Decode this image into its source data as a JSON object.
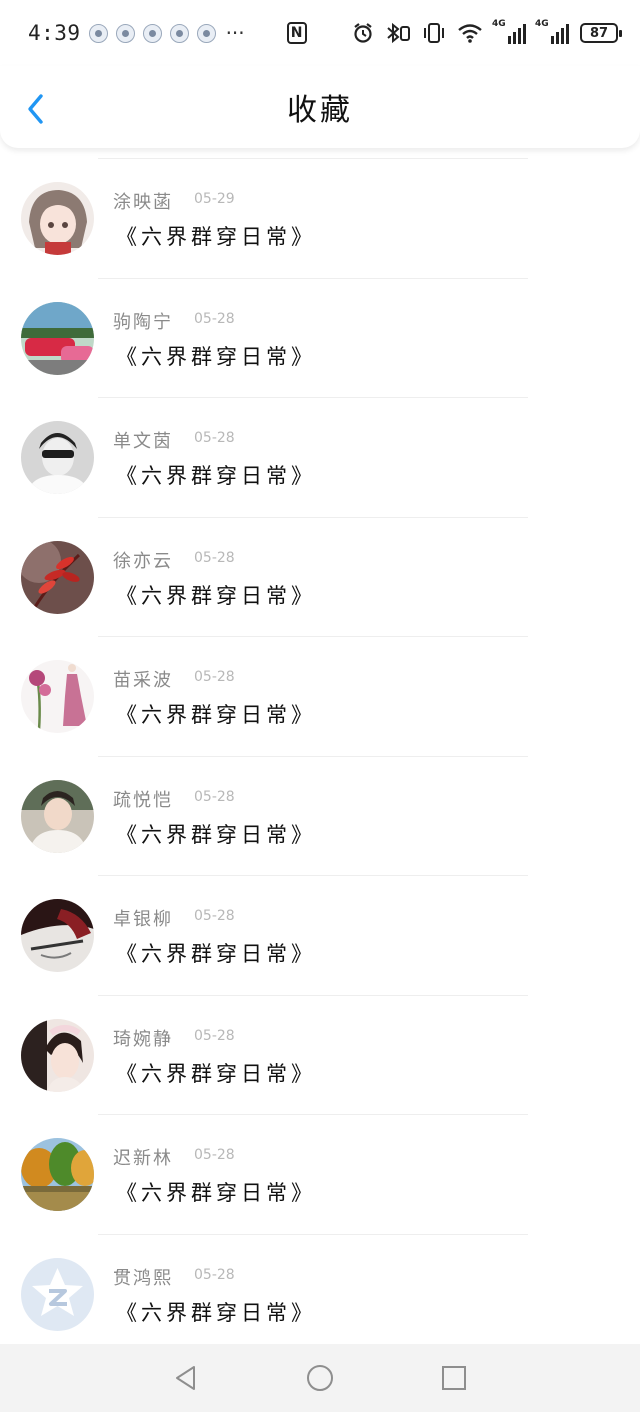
{
  "status_bar": {
    "time": "4:39",
    "more": "···",
    "signal_label_1": "4G",
    "signal_label_2": "4G",
    "battery": "87"
  },
  "header": {
    "title": "收藏",
    "back_icon": "chevron-left-icon",
    "accent_color": "#2196f3"
  },
  "items": [
    {
      "name": "涂映菡",
      "date": "05-29",
      "title": "《六界群穿日常》",
      "avatar_color": "#c8a99a"
    },
    {
      "name": "驹陶宁",
      "date": "05-28",
      "title": "《六界群穿日常》",
      "avatar_color": "#d2405a"
    },
    {
      "name": "单文茵",
      "date": "05-28",
      "title": "《六界群穿日常》",
      "avatar_color": "#9a9a9a"
    },
    {
      "name": "徐亦云",
      "date": "05-28",
      "title": "《六界群穿日常》",
      "avatar_color": "#a8332d"
    },
    {
      "name": "苗采波",
      "date": "05-28",
      "title": "《六界群穿日常》",
      "avatar_color": "#c06a86"
    },
    {
      "name": "疏悦恺",
      "date": "05-28",
      "title": "《六界群穿日常》",
      "avatar_color": "#b7a99b"
    },
    {
      "name": "卓银柳",
      "date": "05-28",
      "title": "《六界群穿日常》",
      "avatar_color": "#5a1e1e"
    },
    {
      "name": "琦婉静",
      "date": "05-28",
      "title": "《六界群穿日常》",
      "avatar_color": "#e6c9c1"
    },
    {
      "name": "迟新林",
      "date": "05-28",
      "title": "《六界群穿日常》",
      "avatar_color": "#c79a2e"
    },
    {
      "name": "贯鸿熙",
      "date": "05-28",
      "title": "《六界群穿日常》",
      "avatar_color": "#dfe8f3"
    }
  ],
  "nav": {
    "back": "triangle-back-icon",
    "home": "circle-home-icon",
    "recents": "square-recents-icon"
  }
}
